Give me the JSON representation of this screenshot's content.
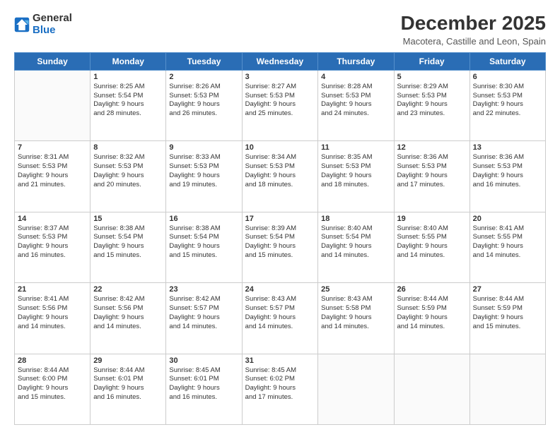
{
  "logo": {
    "general": "General",
    "blue": "Blue"
  },
  "header": {
    "title": "December 2025",
    "subtitle": "Macotera, Castille and Leon, Spain"
  },
  "days_of_week": [
    "Sunday",
    "Monday",
    "Tuesday",
    "Wednesday",
    "Thursday",
    "Friday",
    "Saturday"
  ],
  "weeks": [
    [
      {
        "num": "",
        "info": ""
      },
      {
        "num": "1",
        "info": "Sunrise: 8:25 AM\nSunset: 5:54 PM\nDaylight: 9 hours\nand 28 minutes."
      },
      {
        "num": "2",
        "info": "Sunrise: 8:26 AM\nSunset: 5:53 PM\nDaylight: 9 hours\nand 26 minutes."
      },
      {
        "num": "3",
        "info": "Sunrise: 8:27 AM\nSunset: 5:53 PM\nDaylight: 9 hours\nand 25 minutes."
      },
      {
        "num": "4",
        "info": "Sunrise: 8:28 AM\nSunset: 5:53 PM\nDaylight: 9 hours\nand 24 minutes."
      },
      {
        "num": "5",
        "info": "Sunrise: 8:29 AM\nSunset: 5:53 PM\nDaylight: 9 hours\nand 23 minutes."
      },
      {
        "num": "6",
        "info": "Sunrise: 8:30 AM\nSunset: 5:53 PM\nDaylight: 9 hours\nand 22 minutes."
      }
    ],
    [
      {
        "num": "7",
        "info": "Sunrise: 8:31 AM\nSunset: 5:53 PM\nDaylight: 9 hours\nand 21 minutes."
      },
      {
        "num": "8",
        "info": "Sunrise: 8:32 AM\nSunset: 5:53 PM\nDaylight: 9 hours\nand 20 minutes."
      },
      {
        "num": "9",
        "info": "Sunrise: 8:33 AM\nSunset: 5:53 PM\nDaylight: 9 hours\nand 19 minutes."
      },
      {
        "num": "10",
        "info": "Sunrise: 8:34 AM\nSunset: 5:53 PM\nDaylight: 9 hours\nand 18 minutes."
      },
      {
        "num": "11",
        "info": "Sunrise: 8:35 AM\nSunset: 5:53 PM\nDaylight: 9 hours\nand 18 minutes."
      },
      {
        "num": "12",
        "info": "Sunrise: 8:36 AM\nSunset: 5:53 PM\nDaylight: 9 hours\nand 17 minutes."
      },
      {
        "num": "13",
        "info": "Sunrise: 8:36 AM\nSunset: 5:53 PM\nDaylight: 9 hours\nand 16 minutes."
      }
    ],
    [
      {
        "num": "14",
        "info": "Sunrise: 8:37 AM\nSunset: 5:53 PM\nDaylight: 9 hours\nand 16 minutes."
      },
      {
        "num": "15",
        "info": "Sunrise: 8:38 AM\nSunset: 5:54 PM\nDaylight: 9 hours\nand 15 minutes."
      },
      {
        "num": "16",
        "info": "Sunrise: 8:38 AM\nSunset: 5:54 PM\nDaylight: 9 hours\nand 15 minutes."
      },
      {
        "num": "17",
        "info": "Sunrise: 8:39 AM\nSunset: 5:54 PM\nDaylight: 9 hours\nand 15 minutes."
      },
      {
        "num": "18",
        "info": "Sunrise: 8:40 AM\nSunset: 5:54 PM\nDaylight: 9 hours\nand 14 minutes."
      },
      {
        "num": "19",
        "info": "Sunrise: 8:40 AM\nSunset: 5:55 PM\nDaylight: 9 hours\nand 14 minutes."
      },
      {
        "num": "20",
        "info": "Sunrise: 8:41 AM\nSunset: 5:55 PM\nDaylight: 9 hours\nand 14 minutes."
      }
    ],
    [
      {
        "num": "21",
        "info": "Sunrise: 8:41 AM\nSunset: 5:56 PM\nDaylight: 9 hours\nand 14 minutes."
      },
      {
        "num": "22",
        "info": "Sunrise: 8:42 AM\nSunset: 5:56 PM\nDaylight: 9 hours\nand 14 minutes."
      },
      {
        "num": "23",
        "info": "Sunrise: 8:42 AM\nSunset: 5:57 PM\nDaylight: 9 hours\nand 14 minutes."
      },
      {
        "num": "24",
        "info": "Sunrise: 8:43 AM\nSunset: 5:57 PM\nDaylight: 9 hours\nand 14 minutes."
      },
      {
        "num": "25",
        "info": "Sunrise: 8:43 AM\nSunset: 5:58 PM\nDaylight: 9 hours\nand 14 minutes."
      },
      {
        "num": "26",
        "info": "Sunrise: 8:44 AM\nSunset: 5:59 PM\nDaylight: 9 hours\nand 14 minutes."
      },
      {
        "num": "27",
        "info": "Sunrise: 8:44 AM\nSunset: 5:59 PM\nDaylight: 9 hours\nand 15 minutes."
      }
    ],
    [
      {
        "num": "28",
        "info": "Sunrise: 8:44 AM\nSunset: 6:00 PM\nDaylight: 9 hours\nand 15 minutes."
      },
      {
        "num": "29",
        "info": "Sunrise: 8:44 AM\nSunset: 6:01 PM\nDaylight: 9 hours\nand 16 minutes."
      },
      {
        "num": "30",
        "info": "Sunrise: 8:45 AM\nSunset: 6:01 PM\nDaylight: 9 hours\nand 16 minutes."
      },
      {
        "num": "31",
        "info": "Sunrise: 8:45 AM\nSunset: 6:02 PM\nDaylight: 9 hours\nand 17 minutes."
      },
      {
        "num": "",
        "info": ""
      },
      {
        "num": "",
        "info": ""
      },
      {
        "num": "",
        "info": ""
      }
    ]
  ]
}
